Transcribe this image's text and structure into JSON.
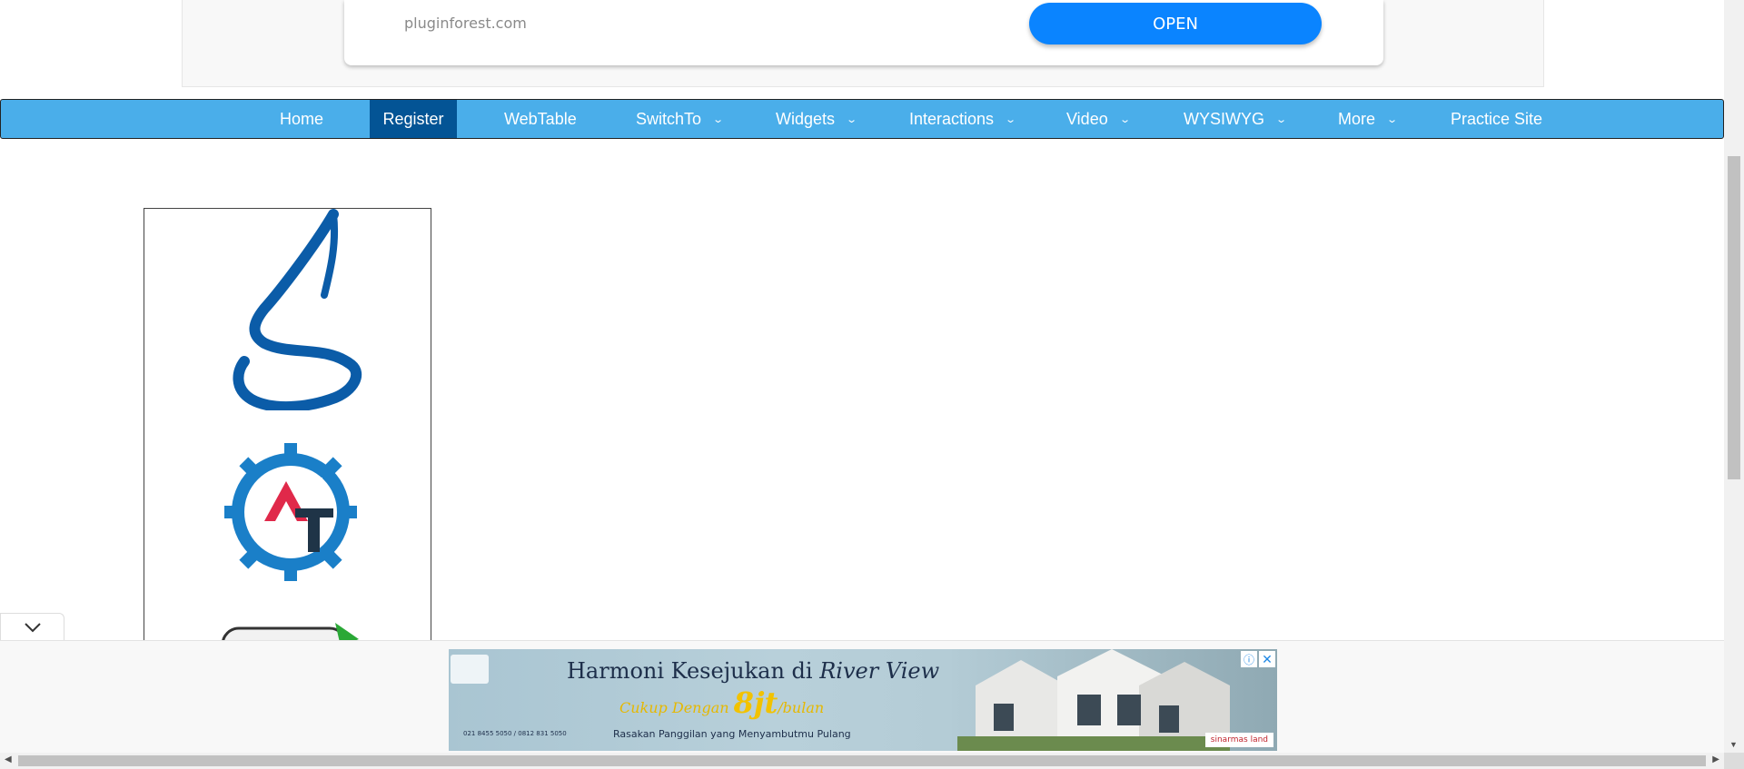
{
  "top_ad": {
    "domain": "pluginforest.com",
    "open_label": "OPEN"
  },
  "nav": {
    "items": [
      {
        "label": "Home",
        "has_dropdown": false,
        "active": false
      },
      {
        "label": "Register",
        "has_dropdown": false,
        "active": true
      },
      {
        "label": "WebTable",
        "has_dropdown": false,
        "active": false
      },
      {
        "label": "SwitchTo",
        "has_dropdown": true,
        "active": false
      },
      {
        "label": "Widgets",
        "has_dropdown": true,
        "active": false
      },
      {
        "label": "Interactions",
        "has_dropdown": true,
        "active": false
      },
      {
        "label": "Video",
        "has_dropdown": true,
        "active": false
      },
      {
        "label": "WYSIWYG",
        "has_dropdown": true,
        "active": false
      },
      {
        "label": "More",
        "has_dropdown": true,
        "active": false
      },
      {
        "label": "Practice Site",
        "has_dropdown": false,
        "active": false
      }
    ]
  },
  "bottom_ad": {
    "title_main": "Harmoni Kesejukan di",
    "title_italic": "River View",
    "sub_prefix": "Cukup Dengan",
    "price": "8jt",
    "sub_suffix": "/bulan",
    "tagline": "Rasakan Panggilan yang Menyambutmu Pulang",
    "phone": "021 8455 5050 / 0812 831 5050",
    "brand": "sinarmas land"
  },
  "colors": {
    "nav_bg": "#4aaeea",
    "nav_active": "#035495",
    "open_button": "#0a84ff"
  },
  "icons": {
    "collapse": "chevron-down-icon",
    "ad_info": "info-icon",
    "ad_close": "close-icon"
  }
}
